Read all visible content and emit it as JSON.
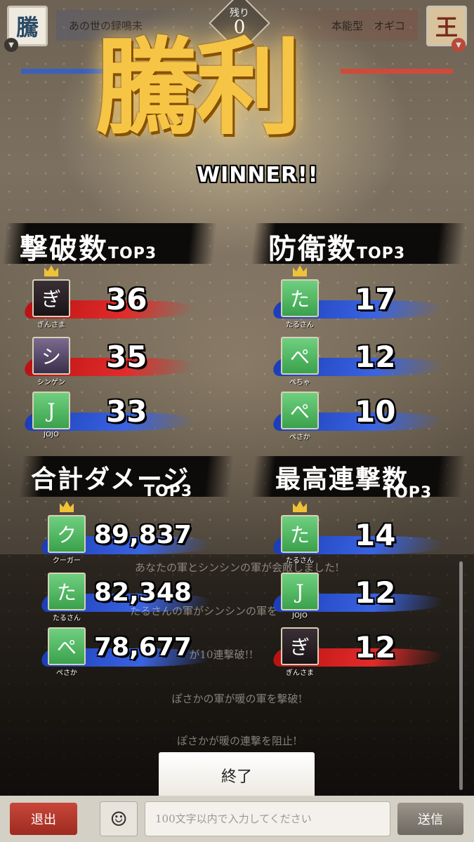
{
  "header": {
    "left_crest": "騰",
    "right_crest": "王",
    "left_team": "あの世の録鳴未",
    "right_team": "本能型　オギコ",
    "remaining_label": "残り",
    "remaining_value": "0",
    "left_dropdown_icon": "chevron-down-icon",
    "right_dropdown_icon": "chevron-down-icon"
  },
  "result": {
    "title": "騰利",
    "subtitle": "WINNER!!"
  },
  "panels": {
    "kills": {
      "title": "撃破数",
      "top": "TOP3",
      "entries": [
        {
          "name": "ぎんさま",
          "score": "36",
          "team": "red",
          "avatar": "ぎ"
        },
        {
          "name": "シンゲン",
          "score": "35",
          "team": "red",
          "avatar": "シ"
        },
        {
          "name": "JOJO",
          "score": "33",
          "team": "blue",
          "avatar": "J"
        }
      ]
    },
    "defense": {
      "title": "防衛数",
      "top": "TOP3",
      "entries": [
        {
          "name": "たるさん",
          "score": "17",
          "team": "blue",
          "avatar": "た"
        },
        {
          "name": "ぺちゃ",
          "score": "12",
          "team": "blue",
          "avatar": "ぺ"
        },
        {
          "name": "ぺさか",
          "score": "10",
          "team": "blue",
          "avatar": "ぺ"
        }
      ]
    },
    "damage": {
      "title": "合計ダメージ",
      "top": "TOP3",
      "entries": [
        {
          "name": "クーガー",
          "score": "89,837",
          "team": "blue",
          "avatar": "ク"
        },
        {
          "name": "たるさん",
          "score": "82,348",
          "team": "blue",
          "avatar": "た"
        },
        {
          "name": "ぺさか",
          "score": "78,677",
          "team": "blue",
          "avatar": "ぺ"
        }
      ]
    },
    "combo": {
      "title": "最高連撃数",
      "top": "TOP3",
      "entries": [
        {
          "name": "たるさん",
          "score": "14",
          "team": "blue",
          "avatar": "た"
        },
        {
          "name": "JOJO",
          "score": "12",
          "team": "blue",
          "avatar": "J"
        },
        {
          "name": "ぎんさま",
          "score": "12",
          "team": "red",
          "avatar": "ぎ"
        }
      ]
    }
  },
  "log": {
    "line1": "あなたの軍とシンシンの軍が会敵しました!",
    "line2": "たるさんの軍がシンシンの軍を",
    "line3": "が10連撃破!!",
    "line4": "ぽさかの軍が暖の軍を撃破!",
    "line5": "ぽさかが暖の連撃を阻止!"
  },
  "end_button": "終了",
  "chat": {
    "exit": "退出",
    "emoji_icon": "smiley-icon",
    "placeholder": "100文字以内で入力してください",
    "send": "送信"
  }
}
